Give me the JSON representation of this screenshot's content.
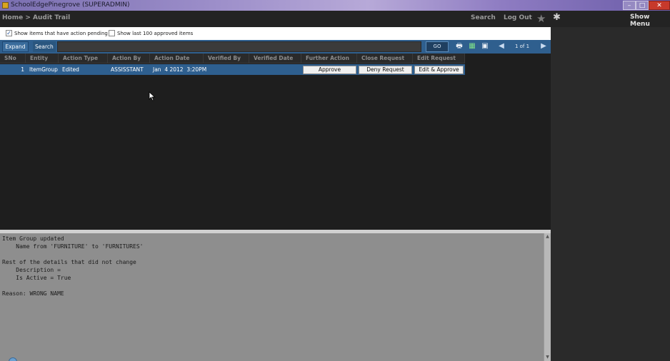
{
  "window": {
    "title": "SchoolEdgePinegrove (SUPERADMIN)",
    "min_glyph": "–",
    "max_glyph": "□",
    "close_glyph": "✕"
  },
  "nav": {
    "breadcrumb": "Home > Audit Trail",
    "search": "Search",
    "logout": "Log Out",
    "show_menu": "Show Menu",
    "star_glyph": "★",
    "asterisk_glyph": "✱"
  },
  "filters": {
    "pending_label": "Show items that have action pending",
    "pending_checked": "✓",
    "approved_label": "Show last 100 approved items"
  },
  "toolbar": {
    "expand": "Expand",
    "search_label": "Search",
    "search_value": "",
    "go": "GO",
    "page_info": "1 of 1",
    "print_glyph": "🖶",
    "excel_glyph": "▦",
    "save_glyph": "▣",
    "prev_glyph": "◀",
    "next_glyph": "▶"
  },
  "grid": {
    "columns": [
      "SNo",
      "Entity",
      "Action Type",
      "Action By",
      "Action Date",
      "Verified By",
      "Verified Date",
      "Further Action",
      "Close Request",
      "Edit Request"
    ],
    "rows": [
      {
        "sno": "1",
        "entity": "ItemGroup",
        "action_type": "Edited",
        "action_by": "ASSISSTANT",
        "action_date": "Jan  4 2012  3:20PM",
        "verified_by": "",
        "verified_date": "",
        "further_action": "Approve",
        "close_request": "Deny Request",
        "edit_request": "Edit & Approve"
      }
    ]
  },
  "details": {
    "text": "Item Group updated\n    Name from 'FURNITURE' to 'FURNITURES'\n\nRest of the details that did not change\n    Description =\n    Is Active = True\n\nReason: WRONG NAME"
  }
}
